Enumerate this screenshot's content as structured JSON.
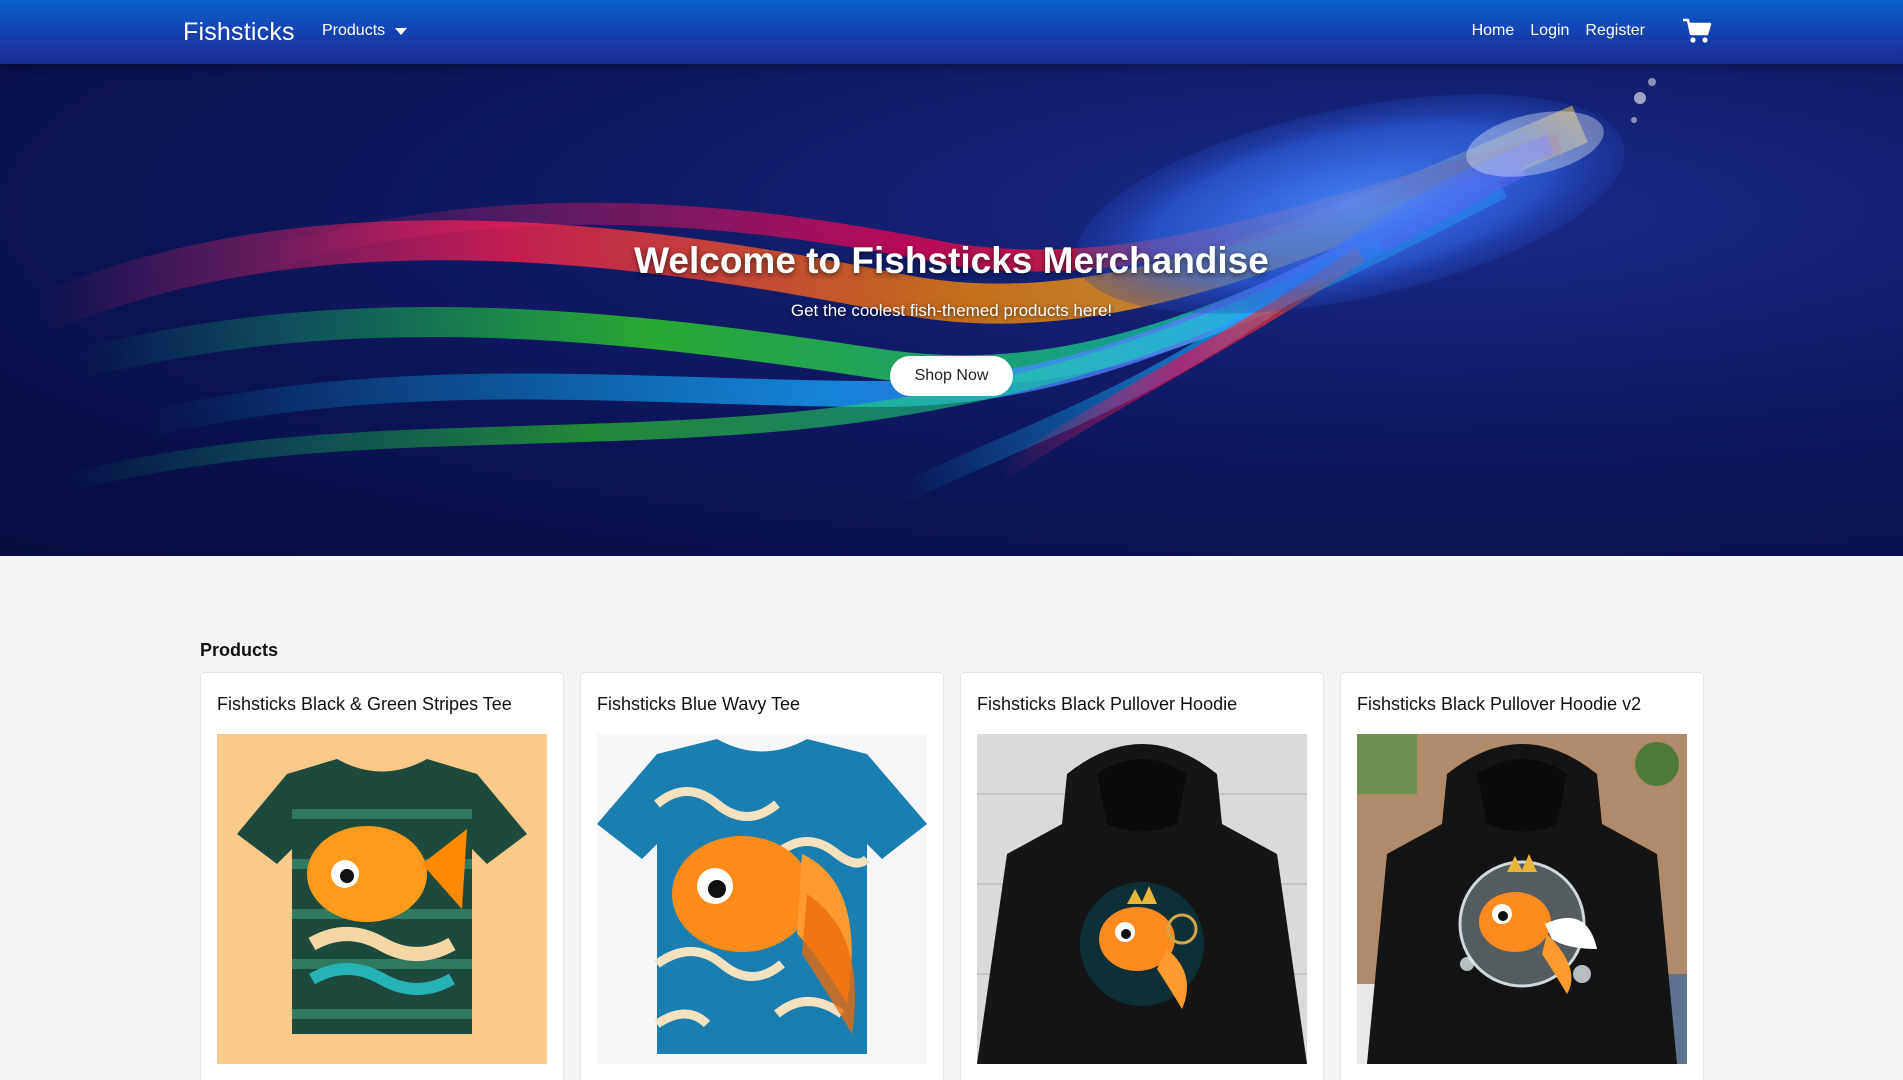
{
  "navbar": {
    "brand": "Fishsticks",
    "products_menu": "Products",
    "links": [
      "Home",
      "Login",
      "Register"
    ],
    "cart_icon": "shopping-cart-icon"
  },
  "hero": {
    "title": "Welcome to Fishsticks Merchandise",
    "subtitle": "Get the coolest fish-themed products here!",
    "cta": "Shop Now"
  },
  "products": {
    "heading": "Products",
    "items": [
      {
        "name": "Fishsticks Black & Green Stripes Tee"
      },
      {
        "name": "Fishsticks Blue Wavy Tee"
      },
      {
        "name": "Fishsticks Black Pullover Hoodie"
      },
      {
        "name": "Fishsticks Black Pullover Hoodie v2"
      }
    ]
  },
  "colors": {
    "nav_top": "#0a62c8",
    "nav_bottom": "#1a2a8f",
    "hero_bg": "#070b3f",
    "page_bg": "#f3f4f6"
  }
}
